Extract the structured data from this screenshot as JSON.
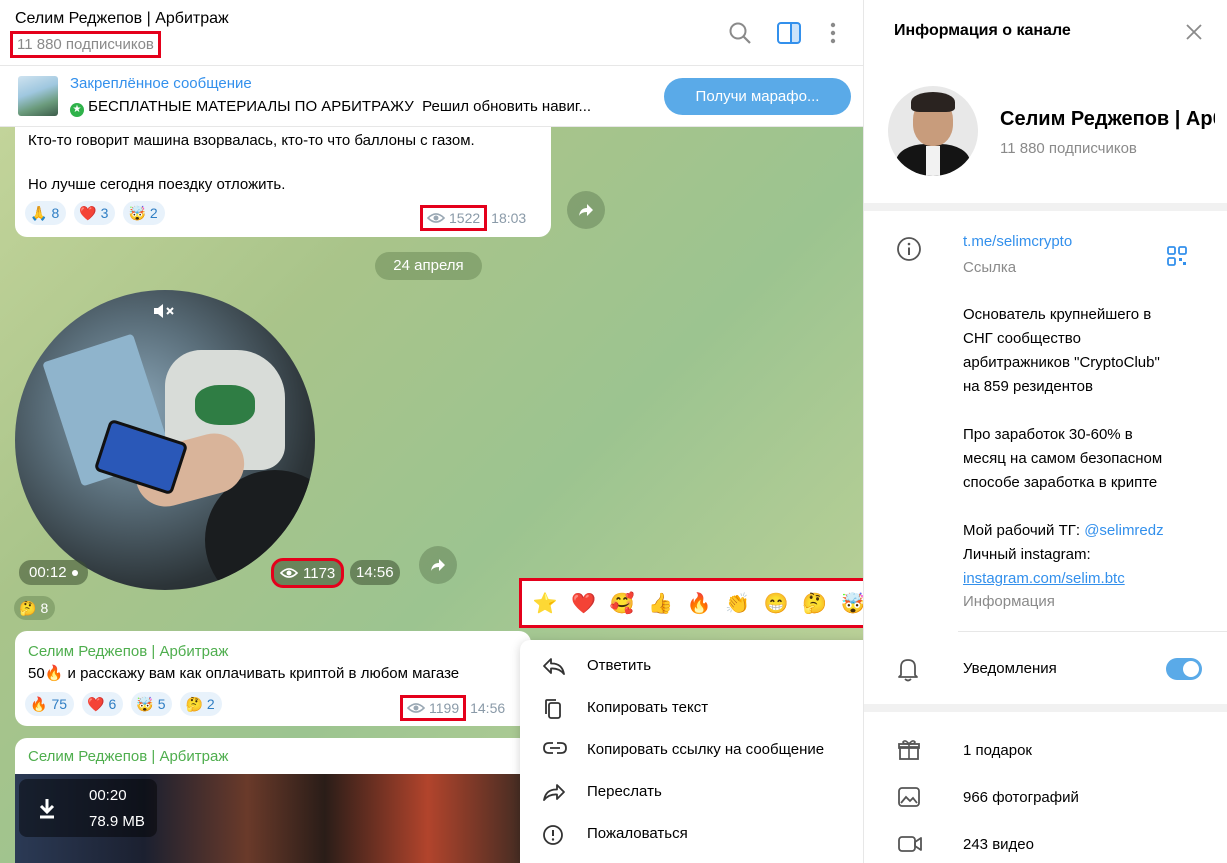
{
  "header": {
    "channel_title": "Селим Реджепов | Арбитраж",
    "subscribers": "11 880 подписчиков"
  },
  "pinned": {
    "title": "Закреплённое сообщение",
    "text": "БЕСПЛАТНЫЕ МАТЕРИАЛЫ ПО АРБИТРАЖУ",
    "text_rest": "Решил обновить навиг...",
    "button": "Получи марафо..."
  },
  "messages": [
    {
      "lines": [
        "Кто-то говорит машина взорвалась, кто-то что баллоны с газом.",
        "Но лучше сегодня поездку отложить."
      ],
      "reactions": [
        {
          "emoji": "🙏",
          "count": "8"
        },
        {
          "emoji": "❤️",
          "count": "3"
        },
        {
          "emoji": "🤯",
          "count": "2"
        }
      ],
      "views": "1522",
      "time": "18:03"
    },
    {
      "date": "24 апреля",
      "duration": "00:12",
      "views": "1173",
      "time": "14:56",
      "reactions": [
        {
          "emoji": "🤔",
          "count": "8"
        }
      ]
    },
    {
      "author": "Селим Реджепов | Арбитраж",
      "text_prefix": "50",
      "text": "и расскажу вам как оплачивать криптой в любом магазе",
      "reactions": [
        {
          "emoji": "🔥",
          "count": "75"
        },
        {
          "emoji": "❤️",
          "count": "6"
        },
        {
          "emoji": "🤯",
          "count": "5"
        },
        {
          "emoji": "🤔",
          "count": "2"
        }
      ],
      "views": "1199",
      "time": "14:56"
    },
    {
      "author": "Селим Реджепов | Арбитраж",
      "duration": "00:20",
      "size": "78.9 MB"
    }
  ],
  "emoji_bar": [
    "⭐",
    "❤️",
    "🥰",
    "👍",
    "🔥",
    "👏",
    "😁",
    "🤔",
    "🤯",
    "🙏"
  ],
  "context_menu": [
    "Ответить",
    "Копировать текст",
    "Копировать ссылку на сообщение",
    "Переслать",
    "Пожаловаться"
  ],
  "side": {
    "title": "Информация о канале",
    "name": "Селим Реджепов | Арбитраж",
    "subscribers": "11 880 подписчиков",
    "link": "t.me/selimcrypto",
    "link_label": "Ссылка",
    "about_lines": [
      "Основатель крупнейшего в",
      "СНГ сообщество",
      "арбитражников \"CryptoClub\"",
      "на 859 резидентов",
      "",
      "Про заработок 30-60% в",
      "месяц на самом безопасном",
      "способе заработка в крипте",
      ""
    ],
    "about_tg_prefix": "Мой рабочий ТГ: ",
    "about_tg": "@selimredz",
    "about_insta_prefix": "Личный instagram:",
    "about_insta": "instagram.com/selim.btc",
    "about_label": "Информация",
    "notifications": "Уведомления",
    "gifts": "1 подарок",
    "photos": "966 фотографий",
    "videos": "243 видео"
  },
  "colors": {
    "accent": "#3390ec",
    "author_green": "#4fae4e",
    "highlight": "#e4001b"
  }
}
